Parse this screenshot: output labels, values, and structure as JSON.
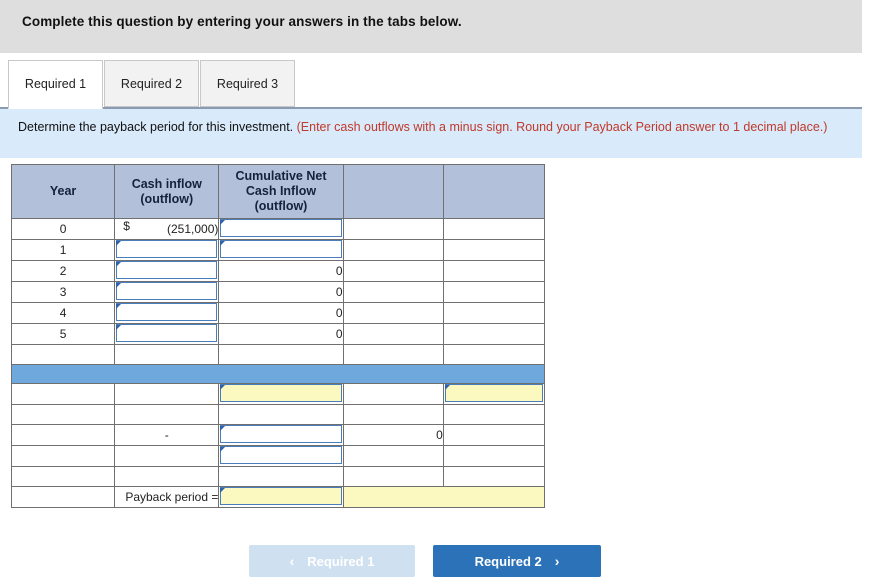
{
  "banner": {
    "text": "Complete this question by entering your answers in the tabs below."
  },
  "tabs": [
    {
      "label": "Required 1",
      "active": true
    },
    {
      "label": "Required 2",
      "active": false
    },
    {
      "label": "Required 3",
      "active": false
    }
  ],
  "instruction": {
    "main": "Determine the payback period for this investment.",
    "hint": "(Enter cash outflows with a minus sign. Round your Payback Period answer to 1 decimal place.)"
  },
  "table": {
    "headers": [
      "Year",
      "Cash inflow (outflow)",
      "Cumulative Net Cash Inflow (outflow)",
      "",
      ""
    ],
    "header_lines": {
      "col1": [
        "Year"
      ],
      "col2": [
        "Cash inflow",
        "(outflow)"
      ],
      "col3": [
        "Cumulative Net",
        "Cash Inflow",
        "(outflow)"
      ],
      "col4": [
        ""
      ],
      "col5": [
        ""
      ]
    },
    "rows": [
      {
        "year": "0",
        "currency": "$",
        "cash": "(251,000)",
        "cash_input": false,
        "cum": "",
        "cum_input": true
      },
      {
        "year": "1",
        "currency": "",
        "cash": "",
        "cash_input": true,
        "cum": "",
        "cum_input": true
      },
      {
        "year": "2",
        "currency": "",
        "cash": "",
        "cash_input": true,
        "cum": "0",
        "cum_input": false
      },
      {
        "year": "3",
        "currency": "",
        "cash": "",
        "cash_input": true,
        "cum": "0",
        "cum_input": false
      },
      {
        "year": "4",
        "currency": "",
        "cash": "",
        "cash_input": true,
        "cum": "0",
        "cum_input": false
      },
      {
        "year": "5",
        "currency": "",
        "cash": "",
        "cash_input": true,
        "cum": "0",
        "cum_input": false
      }
    ],
    "summary": {
      "yellow_row": {
        "col3_value": "",
        "col5_value": ""
      },
      "dash_row": {
        "label": "-",
        "col3_value": "",
        "col4_value": "0"
      },
      "second_input_row": {
        "col3_value": ""
      },
      "payback": {
        "label": "Payback period =",
        "value": ""
      }
    }
  },
  "footer": {
    "prev_label": "Required 1",
    "prev_chevron": "‹",
    "next_label": "Required 2",
    "next_chevron": "›"
  },
  "colors": {
    "banner_bg": "#dedede",
    "instruction_bg": "#d9eafa",
    "hint_text": "#c0392b",
    "table_header_bg": "#b3c0da",
    "blue_bar": "#6fa8dc",
    "input_border": "#4a7ebb",
    "input_yellow": "#fbf8c0",
    "next_button": "#2c72b8",
    "prev_button": "#cfe0f0"
  }
}
